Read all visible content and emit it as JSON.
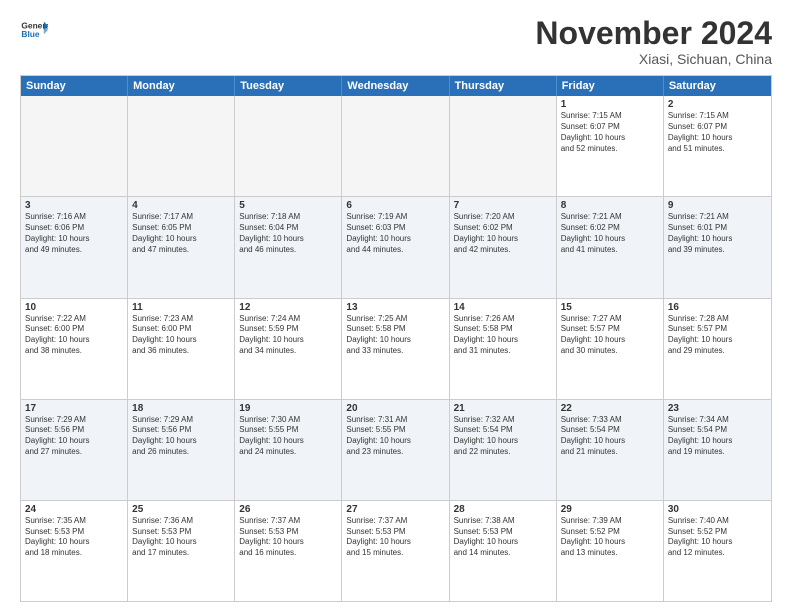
{
  "header": {
    "logo_line1": "General",
    "logo_line2": "Blue",
    "month_title": "November 2024",
    "location": "Xiasi, Sichuan, China"
  },
  "days_of_week": [
    "Sunday",
    "Monday",
    "Tuesday",
    "Wednesday",
    "Thursday",
    "Friday",
    "Saturday"
  ],
  "rows": [
    {
      "alt": false,
      "cells": [
        {
          "empty": true,
          "day": "",
          "text": ""
        },
        {
          "empty": true,
          "day": "",
          "text": ""
        },
        {
          "empty": true,
          "day": "",
          "text": ""
        },
        {
          "empty": true,
          "day": "",
          "text": ""
        },
        {
          "empty": true,
          "day": "",
          "text": ""
        },
        {
          "empty": false,
          "day": "1",
          "text": "Sunrise: 7:15 AM\nSunset: 6:07 PM\nDaylight: 10 hours\nand 52 minutes."
        },
        {
          "empty": false,
          "day": "2",
          "text": "Sunrise: 7:15 AM\nSunset: 6:07 PM\nDaylight: 10 hours\nand 51 minutes."
        }
      ]
    },
    {
      "alt": true,
      "cells": [
        {
          "empty": false,
          "day": "3",
          "text": "Sunrise: 7:16 AM\nSunset: 6:06 PM\nDaylight: 10 hours\nand 49 minutes."
        },
        {
          "empty": false,
          "day": "4",
          "text": "Sunrise: 7:17 AM\nSunset: 6:05 PM\nDaylight: 10 hours\nand 47 minutes."
        },
        {
          "empty": false,
          "day": "5",
          "text": "Sunrise: 7:18 AM\nSunset: 6:04 PM\nDaylight: 10 hours\nand 46 minutes."
        },
        {
          "empty": false,
          "day": "6",
          "text": "Sunrise: 7:19 AM\nSunset: 6:03 PM\nDaylight: 10 hours\nand 44 minutes."
        },
        {
          "empty": false,
          "day": "7",
          "text": "Sunrise: 7:20 AM\nSunset: 6:02 PM\nDaylight: 10 hours\nand 42 minutes."
        },
        {
          "empty": false,
          "day": "8",
          "text": "Sunrise: 7:21 AM\nSunset: 6:02 PM\nDaylight: 10 hours\nand 41 minutes."
        },
        {
          "empty": false,
          "day": "9",
          "text": "Sunrise: 7:21 AM\nSunset: 6:01 PM\nDaylight: 10 hours\nand 39 minutes."
        }
      ]
    },
    {
      "alt": false,
      "cells": [
        {
          "empty": false,
          "day": "10",
          "text": "Sunrise: 7:22 AM\nSunset: 6:00 PM\nDaylight: 10 hours\nand 38 minutes."
        },
        {
          "empty": false,
          "day": "11",
          "text": "Sunrise: 7:23 AM\nSunset: 6:00 PM\nDaylight: 10 hours\nand 36 minutes."
        },
        {
          "empty": false,
          "day": "12",
          "text": "Sunrise: 7:24 AM\nSunset: 5:59 PM\nDaylight: 10 hours\nand 34 minutes."
        },
        {
          "empty": false,
          "day": "13",
          "text": "Sunrise: 7:25 AM\nSunset: 5:58 PM\nDaylight: 10 hours\nand 33 minutes."
        },
        {
          "empty": false,
          "day": "14",
          "text": "Sunrise: 7:26 AM\nSunset: 5:58 PM\nDaylight: 10 hours\nand 31 minutes."
        },
        {
          "empty": false,
          "day": "15",
          "text": "Sunrise: 7:27 AM\nSunset: 5:57 PM\nDaylight: 10 hours\nand 30 minutes."
        },
        {
          "empty": false,
          "day": "16",
          "text": "Sunrise: 7:28 AM\nSunset: 5:57 PM\nDaylight: 10 hours\nand 29 minutes."
        }
      ]
    },
    {
      "alt": true,
      "cells": [
        {
          "empty": false,
          "day": "17",
          "text": "Sunrise: 7:29 AM\nSunset: 5:56 PM\nDaylight: 10 hours\nand 27 minutes."
        },
        {
          "empty": false,
          "day": "18",
          "text": "Sunrise: 7:29 AM\nSunset: 5:56 PM\nDaylight: 10 hours\nand 26 minutes."
        },
        {
          "empty": false,
          "day": "19",
          "text": "Sunrise: 7:30 AM\nSunset: 5:55 PM\nDaylight: 10 hours\nand 24 minutes."
        },
        {
          "empty": false,
          "day": "20",
          "text": "Sunrise: 7:31 AM\nSunset: 5:55 PM\nDaylight: 10 hours\nand 23 minutes."
        },
        {
          "empty": false,
          "day": "21",
          "text": "Sunrise: 7:32 AM\nSunset: 5:54 PM\nDaylight: 10 hours\nand 22 minutes."
        },
        {
          "empty": false,
          "day": "22",
          "text": "Sunrise: 7:33 AM\nSunset: 5:54 PM\nDaylight: 10 hours\nand 21 minutes."
        },
        {
          "empty": false,
          "day": "23",
          "text": "Sunrise: 7:34 AM\nSunset: 5:54 PM\nDaylight: 10 hours\nand 19 minutes."
        }
      ]
    },
    {
      "alt": false,
      "cells": [
        {
          "empty": false,
          "day": "24",
          "text": "Sunrise: 7:35 AM\nSunset: 5:53 PM\nDaylight: 10 hours\nand 18 minutes."
        },
        {
          "empty": false,
          "day": "25",
          "text": "Sunrise: 7:36 AM\nSunset: 5:53 PM\nDaylight: 10 hours\nand 17 minutes."
        },
        {
          "empty": false,
          "day": "26",
          "text": "Sunrise: 7:37 AM\nSunset: 5:53 PM\nDaylight: 10 hours\nand 16 minutes."
        },
        {
          "empty": false,
          "day": "27",
          "text": "Sunrise: 7:37 AM\nSunset: 5:53 PM\nDaylight: 10 hours\nand 15 minutes."
        },
        {
          "empty": false,
          "day": "28",
          "text": "Sunrise: 7:38 AM\nSunset: 5:53 PM\nDaylight: 10 hours\nand 14 minutes."
        },
        {
          "empty": false,
          "day": "29",
          "text": "Sunrise: 7:39 AM\nSunset: 5:52 PM\nDaylight: 10 hours\nand 13 minutes."
        },
        {
          "empty": false,
          "day": "30",
          "text": "Sunrise: 7:40 AM\nSunset: 5:52 PM\nDaylight: 10 hours\nand 12 minutes."
        }
      ]
    }
  ]
}
